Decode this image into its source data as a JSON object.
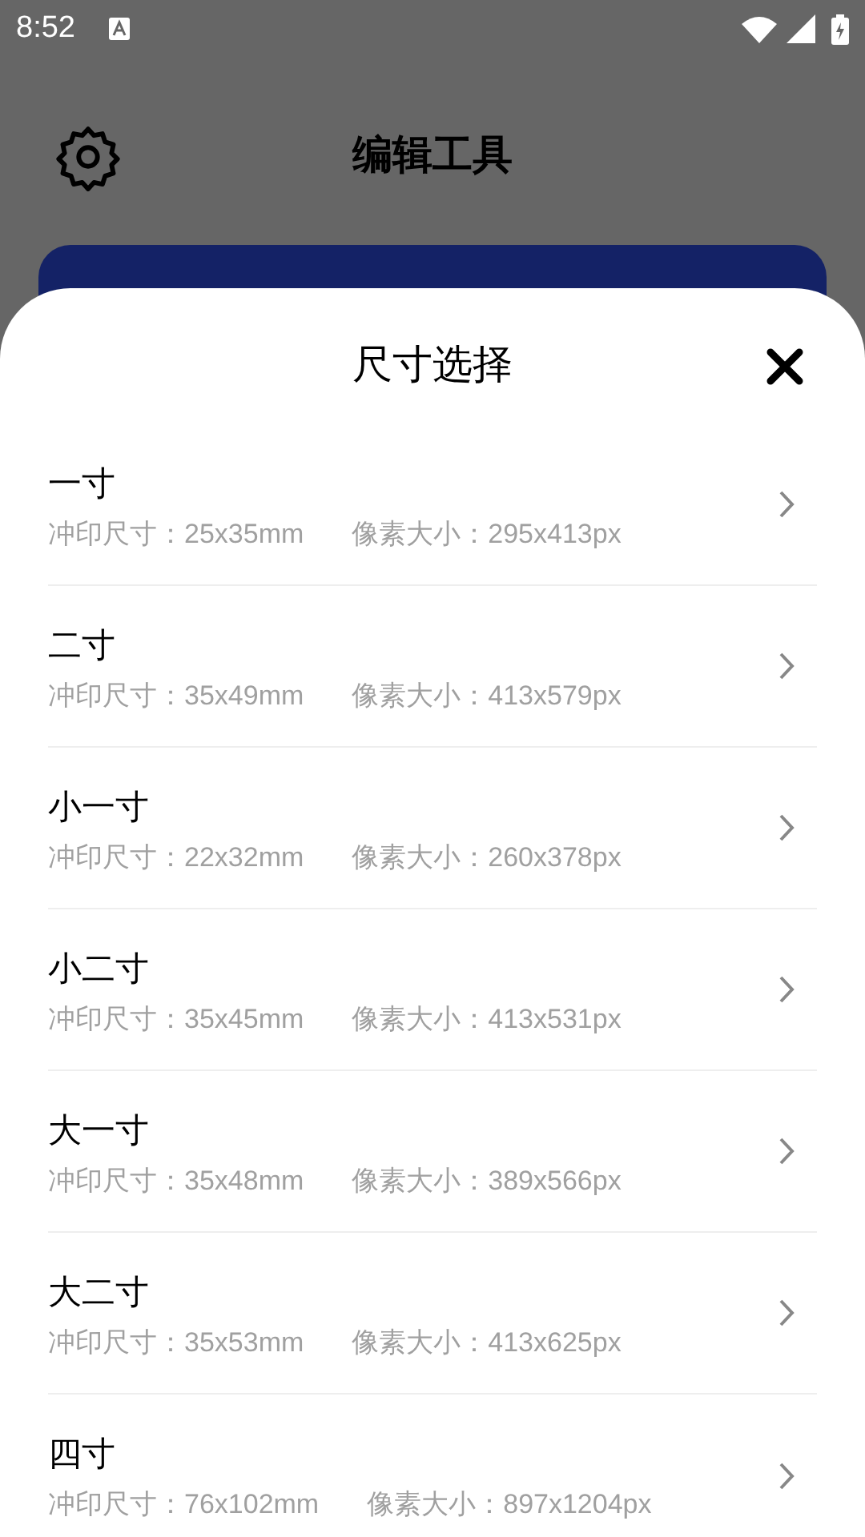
{
  "status_bar": {
    "time": "8:52"
  },
  "header": {
    "title": "编辑工具"
  },
  "sheet": {
    "title": "尺寸选择",
    "items": [
      {
        "name": "一寸",
        "print_size": "冲印尺寸：25x35mm",
        "pixel_size": "像素大小：295x413px"
      },
      {
        "name": "二寸",
        "print_size": "冲印尺寸：35x49mm",
        "pixel_size": "像素大小：413x579px"
      },
      {
        "name": "小一寸",
        "print_size": "冲印尺寸：22x32mm",
        "pixel_size": "像素大小：260x378px"
      },
      {
        "name": "小二寸",
        "print_size": "冲印尺寸：35x45mm",
        "pixel_size": "像素大小：413x531px"
      },
      {
        "name": "大一寸",
        "print_size": "冲印尺寸：35x48mm",
        "pixel_size": "像素大小：389x566px"
      },
      {
        "name": "大二寸",
        "print_size": "冲印尺寸：35x53mm",
        "pixel_size": "像素大小：413x625px"
      },
      {
        "name": "四寸",
        "print_size": "冲印尺寸：76x102mm",
        "pixel_size": "像素大小：897x1204px"
      }
    ]
  }
}
